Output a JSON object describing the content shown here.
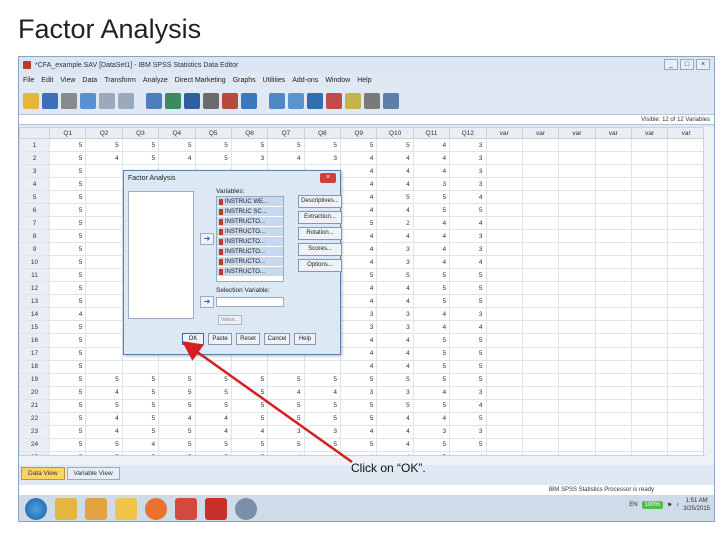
{
  "slide": {
    "title": "Factor Analysis",
    "annotation": "Click on “OK”."
  },
  "window": {
    "title": "*CFA_example.SAV [DataSet1] - IBM SPSS Statistics Data Editor",
    "menu": [
      "File",
      "Edit",
      "View",
      "Data",
      "Transform",
      "Analyze",
      "Direct Marketing",
      "Graphs",
      "Utilities",
      "Add-ons",
      "Window",
      "Help"
    ],
    "visible_label": "Visible: 12 of 12 Variables",
    "columns": [
      "Q1",
      "Q2",
      "Q3",
      "Q4",
      "Q5",
      "Q6",
      "Q7",
      "Q8",
      "Q9",
      "Q10",
      "Q11",
      "Q12",
      "var",
      "var",
      "var",
      "var",
      "var",
      "var"
    ],
    "rows": [
      [
        "1",
        "5",
        "5",
        "5",
        "5",
        "5",
        "5",
        "5",
        "5",
        "5",
        "5",
        "4",
        "3"
      ],
      [
        "2",
        "5",
        "4",
        "5",
        "4",
        "5",
        "3",
        "4",
        "3",
        "4",
        "4",
        "4",
        "3"
      ],
      [
        "3",
        "5",
        "",
        "",
        "",
        "",
        "",
        "",
        "",
        "4",
        "4",
        "4",
        "3"
      ],
      [
        "4",
        "5",
        "",
        "",
        "",
        "",
        "",
        "",
        "",
        "4",
        "4",
        "3",
        "3"
      ],
      [
        "5",
        "5",
        "",
        "",
        "",
        "",
        "",
        "",
        "",
        "4",
        "5",
        "5",
        "4"
      ],
      [
        "6",
        "5",
        "",
        "",
        "",
        "",
        "",
        "",
        "",
        "4",
        "4",
        "5",
        "5"
      ],
      [
        "7",
        "5",
        "",
        "",
        "",
        "",
        "",
        "",
        "",
        "5",
        "2",
        "4",
        "4"
      ],
      [
        "8",
        "5",
        "",
        "",
        "",
        "",
        "",
        "",
        "",
        "4",
        "4",
        "4",
        "3"
      ],
      [
        "9",
        "5",
        "",
        "",
        "",
        "",
        "",
        "",
        "",
        "4",
        "3",
        "4",
        "3"
      ],
      [
        "10",
        "5",
        "",
        "",
        "",
        "",
        "",
        "",
        "",
        "4",
        "3",
        "4",
        "4"
      ],
      [
        "11",
        "5",
        "",
        "",
        "",
        "",
        "",
        "",
        "",
        "5",
        "5",
        "5",
        "5"
      ],
      [
        "12",
        "5",
        "",
        "",
        "",
        "",
        "",
        "",
        "",
        "4",
        "4",
        "5",
        "5"
      ],
      [
        "13",
        "5",
        "",
        "",
        "",
        "",
        "",
        "",
        "",
        "4",
        "4",
        "5",
        "5"
      ],
      [
        "14",
        "4",
        "",
        "",
        "",
        "",
        "",
        "",
        "",
        "3",
        "3",
        "4",
        "3"
      ],
      [
        "15",
        "5",
        "",
        "",
        "",
        "",
        "",
        "",
        "",
        "3",
        "3",
        "4",
        "4"
      ],
      [
        "16",
        "5",
        "",
        "",
        "",
        "",
        "",
        "",
        "",
        "4",
        "4",
        "5",
        "5"
      ],
      [
        "17",
        "5",
        "",
        "",
        "",
        "",
        "",
        "",
        "",
        "4",
        "4",
        "5",
        "5"
      ],
      [
        "18",
        "5",
        "",
        "",
        "",
        "",
        "",
        "",
        "",
        "4",
        "4",
        "5",
        "5"
      ],
      [
        "19",
        "5",
        "5",
        "5",
        "5",
        "5",
        "5",
        "5",
        "5",
        "5",
        "5",
        "5",
        "5"
      ],
      [
        "20",
        "5",
        "4",
        "5",
        "5",
        "5",
        "5",
        "4",
        "4",
        "3",
        "3",
        "4",
        "3"
      ],
      [
        "21",
        "5",
        "5",
        "5",
        "5",
        "5",
        "5",
        "5",
        "5",
        "5",
        "5",
        "5",
        "4"
      ],
      [
        "22",
        "5",
        "4",
        "5",
        "4",
        "4",
        "5",
        "5",
        "5",
        "5",
        "4",
        "4",
        "5"
      ],
      [
        "23",
        "5",
        "4",
        "5",
        "5",
        "4",
        "4",
        "3",
        "3",
        "4",
        "4",
        "3",
        "3"
      ],
      [
        "24",
        "5",
        "5",
        "4",
        "5",
        "5",
        "5",
        "5",
        "5",
        "5",
        "4",
        "5",
        "5"
      ],
      [
        "25",
        "5",
        "5",
        "5",
        "5",
        "5",
        "5",
        "4",
        "4",
        "4",
        "4",
        "5",
        "4"
      ]
    ],
    "tabs": {
      "data_view": "Data View",
      "variable_view": "Variable View"
    },
    "status": "IBM SPSS Statistics Processor is ready",
    "taskbar": {
      "lang": "EN",
      "battery": "100%",
      "time": "1:51 AM",
      "date": "3/25/2015"
    }
  },
  "dialog": {
    "title": "Factor Analysis",
    "variables_label": "Variables:",
    "variables": [
      "INSTRUC WE...",
      "INSTRUC SC...",
      "INSTRUCTO...",
      "INSTRUCTO...",
      "INSTRUCTO...",
      "INSTRUCTO...",
      "INSTRUCTO...",
      "INSTRUCTO..."
    ],
    "selection_label": "Selection Variable:",
    "value_button": "Value...",
    "side_buttons": [
      "Descriptives...",
      "Extraction...",
      "Rotation...",
      "Scores...",
      "Options..."
    ],
    "bottom_buttons": [
      "OK",
      "Paste",
      "Reset",
      "Cancel",
      "Help"
    ]
  }
}
